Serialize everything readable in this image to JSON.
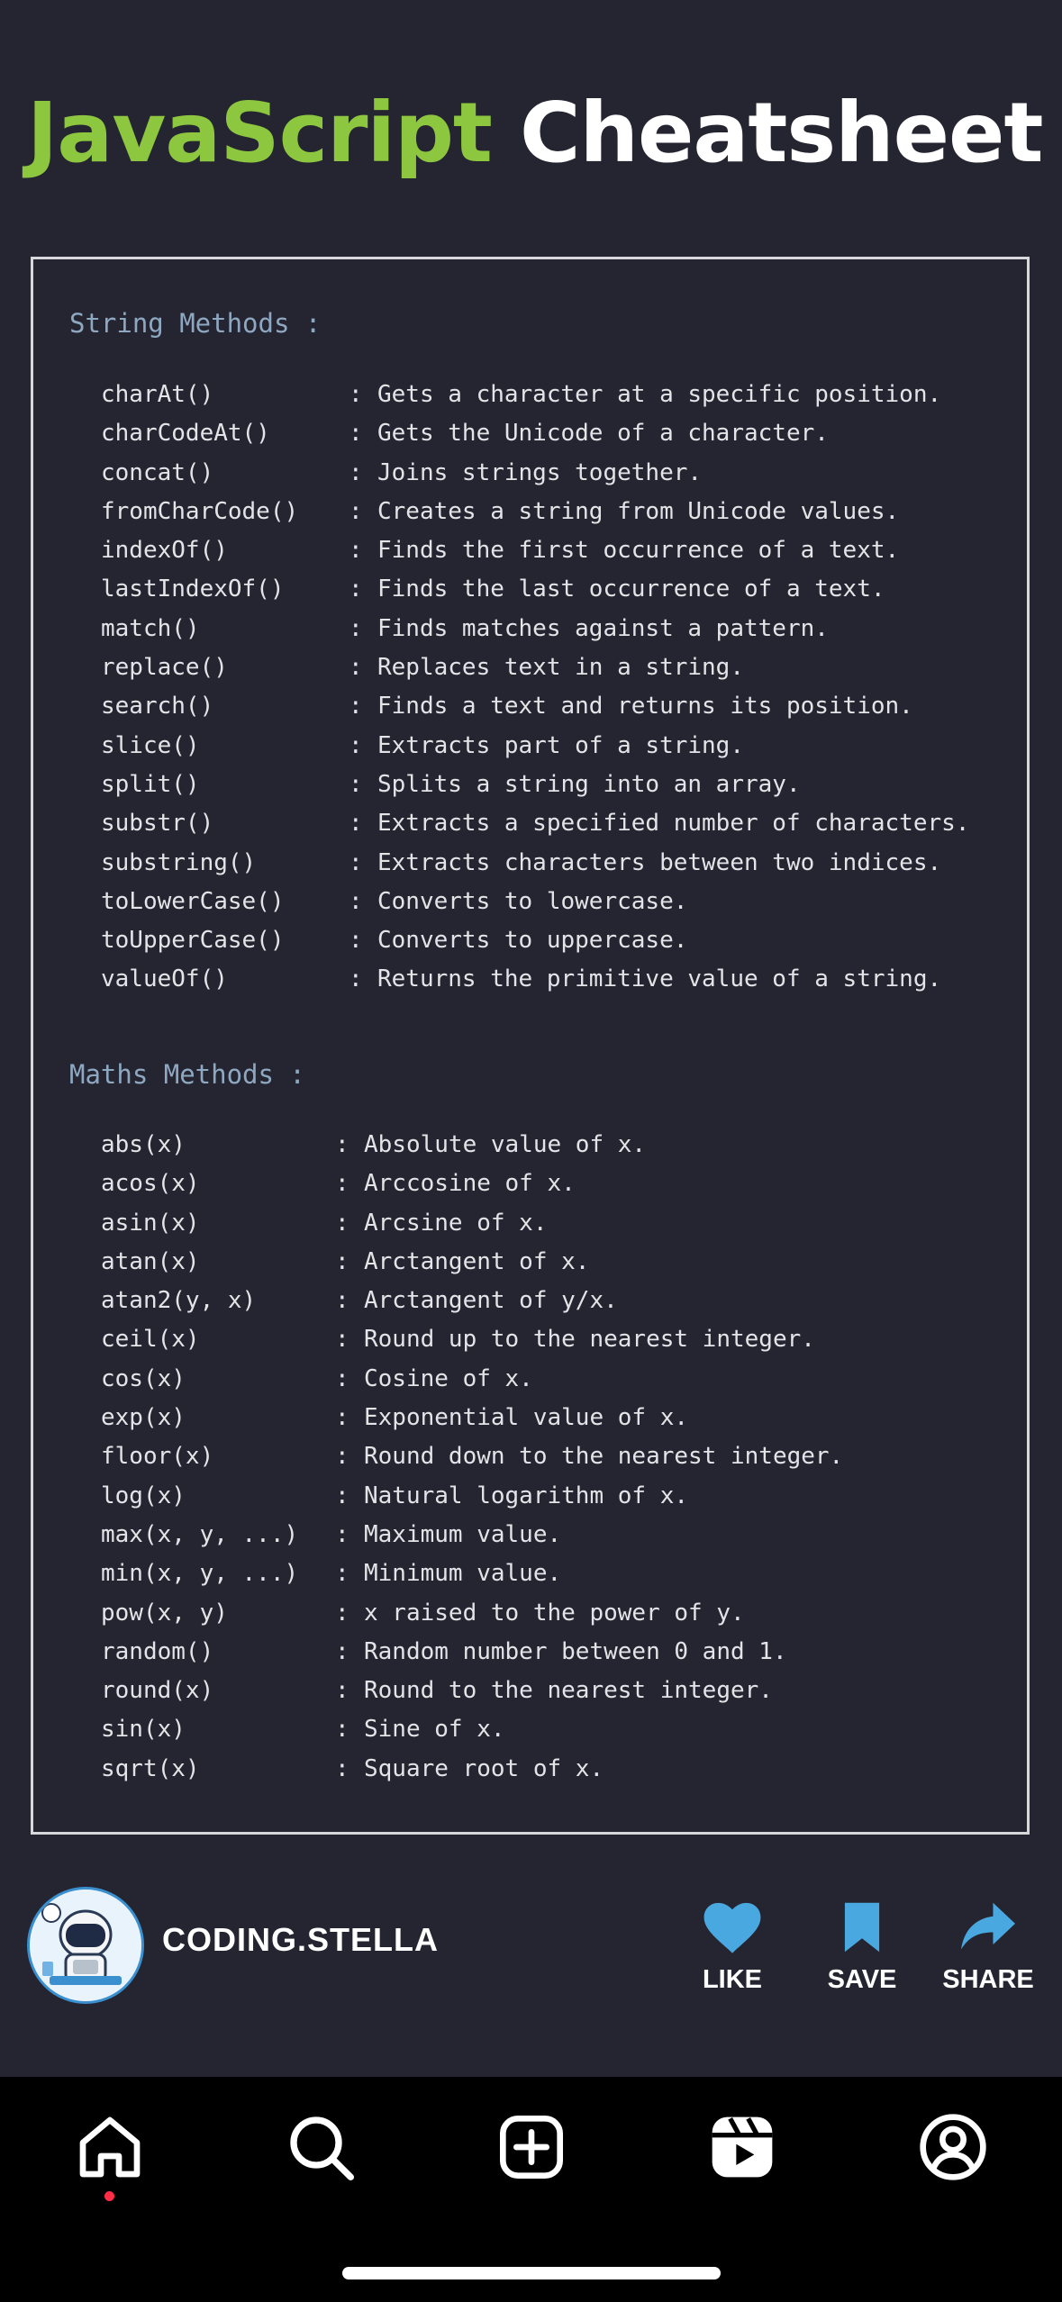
{
  "header": {
    "title_part1": "JavaScript",
    "title_part2": "Cheatsheet"
  },
  "sections": {
    "string": {
      "title": "String Methods :",
      "items": [
        {
          "method": "charAt()",
          "desc": "Gets a character at a specific position."
        },
        {
          "method": "charCodeAt()",
          "desc": "Gets the Unicode of a character."
        },
        {
          "method": "concat()",
          "desc": "Joins strings together."
        },
        {
          "method": "fromCharCode()",
          "desc": "Creates a string from Unicode values."
        },
        {
          "method": "indexOf()",
          "desc": "Finds the first occurrence of a text."
        },
        {
          "method": "lastIndexOf()",
          "desc": "Finds the last occurrence of a text."
        },
        {
          "method": "match()",
          "desc": "Finds matches against a pattern."
        },
        {
          "method": "replace()",
          "desc": "Replaces text in a string."
        },
        {
          "method": "search()",
          "desc": "Finds a text and returns its position."
        },
        {
          "method": "slice()",
          "desc": "Extracts part of a string."
        },
        {
          "method": "split()",
          "desc": "Splits a string into an array."
        },
        {
          "method": "substr()",
          "desc": "Extracts a specified number of characters."
        },
        {
          "method": "substring()",
          "desc": "Extracts characters between two indices."
        },
        {
          "method": "toLowerCase()",
          "desc": "Converts to lowercase."
        },
        {
          "method": "toUpperCase()",
          "desc": "Converts to uppercase."
        },
        {
          "method": "valueOf()",
          "desc": "Returns the primitive value of a string."
        }
      ]
    },
    "math": {
      "title": "Maths Methods :",
      "items": [
        {
          "method": "abs(x)",
          "desc": "Absolute value of x."
        },
        {
          "method": "acos(x)",
          "desc": "Arccosine of x."
        },
        {
          "method": "asin(x)",
          "desc": "Arcsine of x."
        },
        {
          "method": "atan(x)",
          "desc": "Arctangent of x."
        },
        {
          "method": "atan2(y, x)",
          "desc": "Arctangent of y/x."
        },
        {
          "method": "ceil(x)",
          "desc": "Round up to the nearest integer."
        },
        {
          "method": "cos(x)",
          "desc": "Cosine of x."
        },
        {
          "method": "exp(x)",
          "desc": "Exponential value of x."
        },
        {
          "method": "floor(x)",
          "desc": "Round down to the nearest integer."
        },
        {
          "method": "log(x)",
          "desc": "Natural logarithm of x."
        },
        {
          "method": "max(x, y, ...)",
          "desc": "Maximum value."
        },
        {
          "method": "min(x, y, ...)",
          "desc": "Minimum value."
        },
        {
          "method": "pow(x, y)",
          "desc": "x raised to the power of y."
        },
        {
          "method": "random()",
          "desc": "Random number between 0 and 1."
        },
        {
          "method": "round(x)",
          "desc": "Round to the nearest integer."
        },
        {
          "method": "sin(x)",
          "desc": "Sine of x."
        },
        {
          "method": "sqrt(x)",
          "desc": "Square root of x."
        }
      ]
    },
    "separator": ":"
  },
  "author": {
    "username": "CODING.STELLA",
    "avatar_icon": "astronaut-avatar-icon"
  },
  "actions": {
    "like": "LIKE",
    "save": "SAVE",
    "share": "SHARE"
  },
  "nav": {
    "items": [
      "home-icon",
      "search-icon",
      "create-icon",
      "reels-icon",
      "profile-icon"
    ],
    "active": "home-icon"
  },
  "colors": {
    "accent_green": "#8dc63f",
    "background": "#252531",
    "section_title": "#8fa8c2",
    "like_blue": "#4aa8e0",
    "notification_dot": "#ff2d45"
  }
}
